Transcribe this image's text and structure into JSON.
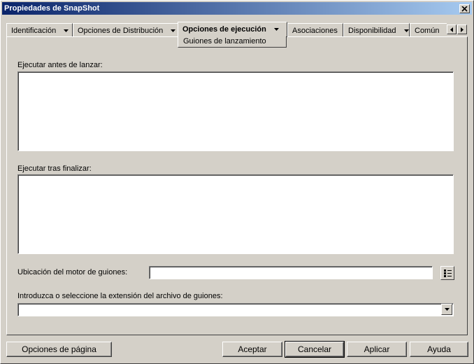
{
  "window": {
    "title": "Propiedades de SnapShot",
    "close_icon": "close-icon"
  },
  "tabs": [
    {
      "label": "Identificación",
      "has_dropdown": true
    },
    {
      "label": "Opciones de Distribución",
      "has_dropdown": true
    },
    {
      "label": "Opciones de ejecución",
      "has_dropdown": true,
      "active": true
    },
    {
      "label": "Asociaciones",
      "has_dropdown": false
    },
    {
      "label": "Disponibilidad",
      "has_dropdown": true
    },
    {
      "label": "Común",
      "has_dropdown": false
    }
  ],
  "submenu": {
    "label": "Guiones de lanzamiento"
  },
  "form": {
    "run_before_label": "Ejecutar antes de lanzar:",
    "run_before_value": "",
    "run_after_label": "Ejecutar tras finalizar:",
    "run_after_value": "",
    "engine_location_label": "Ubicación del motor de guiones:",
    "engine_location_value": "",
    "extension_label": "Introduzca o seleccione la extensión del archivo de guiones:",
    "extension_value": ""
  },
  "footer": {
    "page_options": "Opciones de página",
    "ok": "Aceptar",
    "cancel": "Cancelar",
    "apply": "Aplicar",
    "help": "Ayuda"
  }
}
